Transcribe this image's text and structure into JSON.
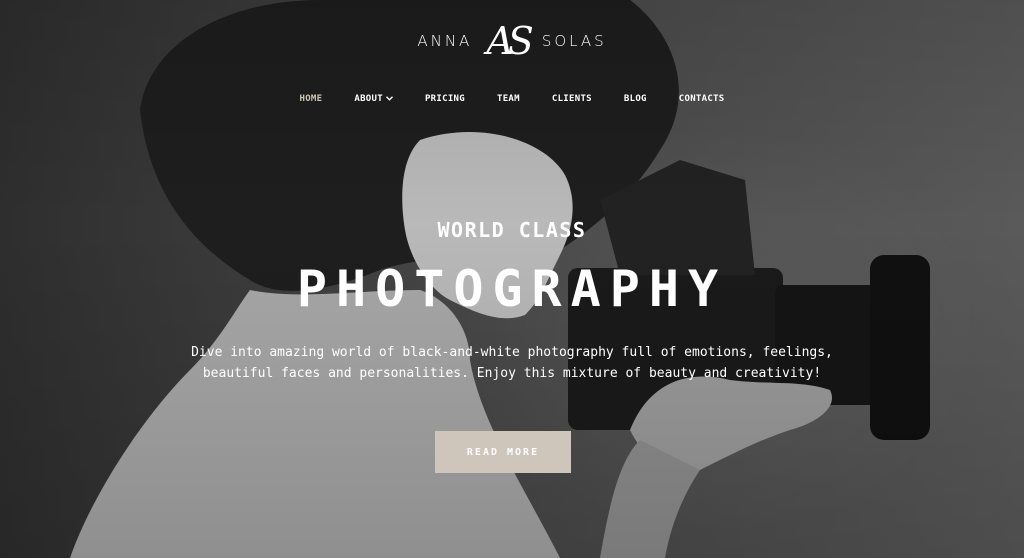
{
  "logo": {
    "left_word": "ANNA",
    "monogram": "AS",
    "right_word": "SOLAS"
  },
  "nav": {
    "items": [
      {
        "label": "HOME",
        "active": true
      },
      {
        "label": "ABOUT",
        "dropdown": true
      },
      {
        "label": "PRICING"
      },
      {
        "label": "TEAM"
      },
      {
        "label": "CLIENTS"
      },
      {
        "label": "BLOG"
      },
      {
        "label": "CONTACTS"
      }
    ],
    "chevron_icon": "chevron-down-icon"
  },
  "hero": {
    "kicker": "WORLD CLASS",
    "headline": "PHOTOGRAPHY",
    "lead_line1": "Dive into amazing world of black-and-white photography full of emotions, feelings,",
    "lead_line2": "beautiful faces and personalities. Enjoy this mixture of beauty and creativity!",
    "cta_label": "READ MORE"
  },
  "colors": {
    "accent": "#cfc6bb",
    "text": "#ffffff",
    "background": "#3a3a3a"
  }
}
